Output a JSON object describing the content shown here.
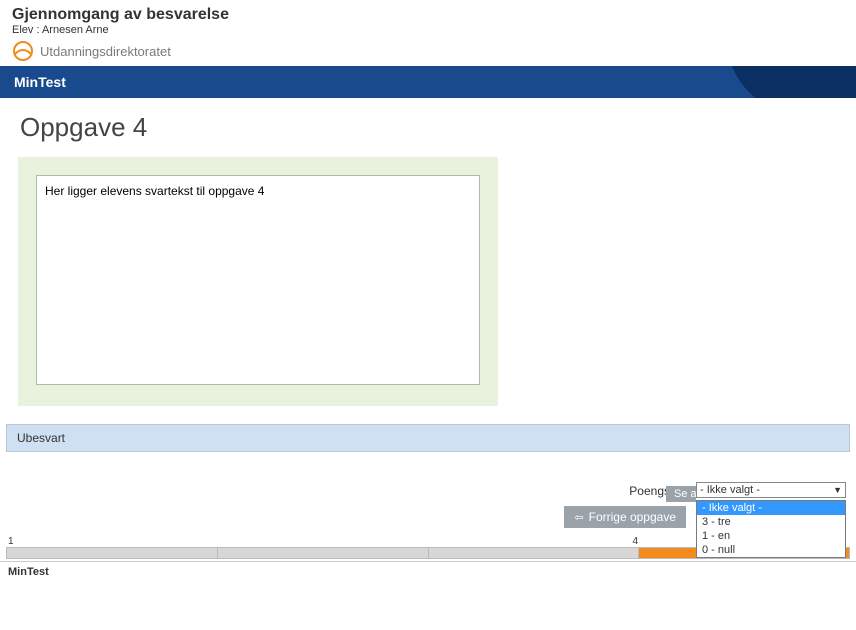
{
  "header": {
    "title": "Gjennomgang av besvarelse",
    "student_label": "Elev :",
    "student_name": "Arnesen Arne",
    "org": "Utdanningsdirektoratet"
  },
  "test_name": "MinTest",
  "task_title": "Oppgave 4",
  "answer_text": "Her ligger elevens svartekst til oppgave 4",
  "status": "Ubesvart",
  "score": {
    "label": "Poengsum:",
    "selected": "- Ikke valgt -",
    "options": [
      "- Ikke valgt -",
      "3 - tre",
      "1 - en",
      "0 - null"
    ]
  },
  "buttons": {
    "see_all": "Se a",
    "prev": "Forrige oppgave"
  },
  "progress": {
    "start": "1",
    "current": "4",
    "segments": [
      {
        "color": "grey"
      },
      {
        "color": "grey"
      },
      {
        "color": "grey"
      },
      {
        "color": "orange"
      }
    ]
  },
  "footer": "MinTest"
}
